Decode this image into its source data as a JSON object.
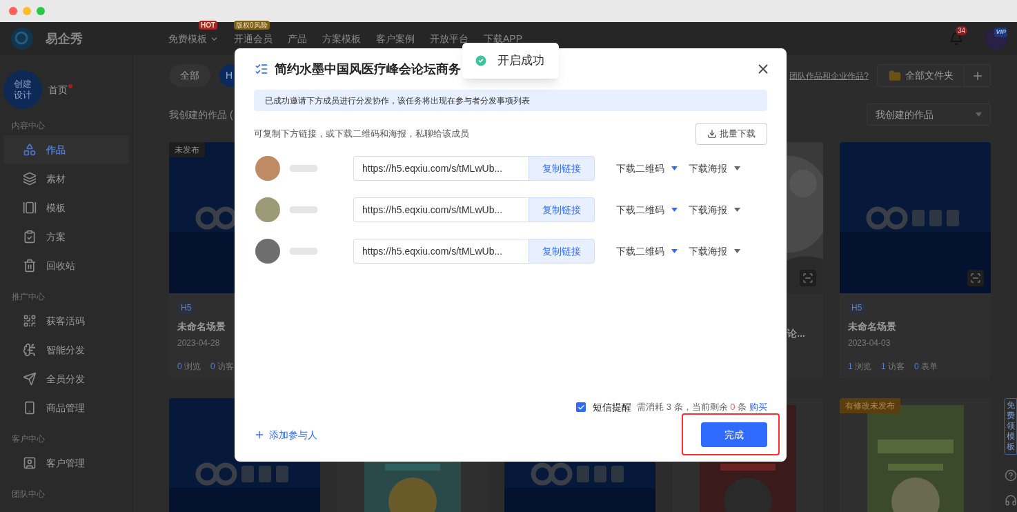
{
  "nav": {
    "brand": "易企秀",
    "items": [
      {
        "label": "免费模板",
        "badge": "HOT",
        "color": "#a32626",
        "dropdown": true
      },
      {
        "label": "开通会员",
        "badge": "版权0风险",
        "color": "#7a6012",
        "dropdown": false
      },
      {
        "label": "产品",
        "dropdown": false
      },
      {
        "label": "方案模板",
        "dropdown": false
      },
      {
        "label": "客户案例",
        "dropdown": false
      },
      {
        "label": "开放平台",
        "dropdown": false
      },
      {
        "label": "下载APP",
        "dropdown": false
      }
    ],
    "notification_count": "34",
    "avatar_badge": "VIP"
  },
  "sidebar": {
    "create_label": "创建设计",
    "home": {
      "label": "首页",
      "unread": true
    },
    "sections": [
      {
        "title": "内容中心",
        "items": [
          {
            "label": "作品",
            "selected": true
          },
          {
            "label": "素材",
            "selected": false
          },
          {
            "label": "模板",
            "selected": false
          },
          {
            "label": "方案",
            "selected": false
          },
          {
            "label": "回收站",
            "selected": false
          }
        ]
      },
      {
        "title": "推广中心",
        "items": [
          {
            "label": "获客活码",
            "selected": false
          },
          {
            "label": "智能分发",
            "selected": false
          },
          {
            "label": "全员分发",
            "selected": false
          },
          {
            "label": "商品管理",
            "selected": false
          }
        ]
      },
      {
        "title": "客户中心",
        "items": [
          {
            "label": "客户管理",
            "selected": false
          }
        ]
      },
      {
        "title": "团队中心"
      }
    ]
  },
  "main": {
    "filter_tabs": [
      {
        "label": "全部",
        "selected": false
      },
      {
        "label": "H",
        "selected": true
      }
    ],
    "team_link": "团队作品和企业作品?",
    "folder_button": "全部文件夹",
    "section_title": "我创建的作品 (",
    "scope_select": "我创建的作品",
    "cards": [
      {
        "kind": "full",
        "status": "未发布",
        "type": "H5",
        "title": "未命名场景",
        "date": "2023-04-28",
        "stats": [
          "0 浏览",
          "0 访客"
        ]
      },
      {
        "kind": "hidden"
      },
      {
        "kind": "hidden"
      },
      {
        "kind": "clipped",
        "title": "论...",
        "qr": true
      },
      {
        "kind": "full",
        "type": "H5",
        "title": "未命名场景",
        "date": "2023-04-03",
        "qr": true,
        "stats": [
          "1 浏览",
          "1 访客",
          "0 表单"
        ]
      },
      {
        "kind": "cover"
      },
      {
        "kind": "cover"
      },
      {
        "kind": "cover"
      },
      {
        "kind": "cover"
      },
      {
        "kind": "cover",
        "status": "有修改未发布"
      }
    ],
    "side_float": "免费领模板"
  },
  "dialog": {
    "title": "简约水墨中国风医疗峰会论坛商务",
    "notice": "已成功邀请下方成员进行分发协作，该任务将出现在参与者分发事项列表",
    "hint": "可复制下方链接，或下载二维码和海报，私聊给该成员",
    "batch_download": "批量下载",
    "members": [
      {
        "color": "#c08a64",
        "link": "https://h5.eqxiu.com/s/tMLwUb...",
        "copy": "复制链接",
        "qr": "下载二维码",
        "poster": "下载海报"
      },
      {
        "color": "#9c9a76",
        "link": "https://h5.eqxiu.com/s/tMLwUb...",
        "copy": "复制链接",
        "qr": "下载二维码",
        "poster": "下载海报"
      },
      {
        "color": "#6e6e6e",
        "link": "https://h5.eqxiu.com/s/tMLwUb...",
        "copy": "复制链接",
        "qr": "下载二维码",
        "poster": "下载海报"
      }
    ],
    "sms": {
      "checked": true,
      "label": "短信提醒",
      "cost": "需消耗 3 条，当前剩余",
      "remaining": "0",
      "unit": "条",
      "buy": "购买"
    },
    "add_participant": "添加参与人",
    "done": "完成",
    "done_highlighted": true
  },
  "toast": {
    "kind": "success",
    "message": "开启成功"
  }
}
